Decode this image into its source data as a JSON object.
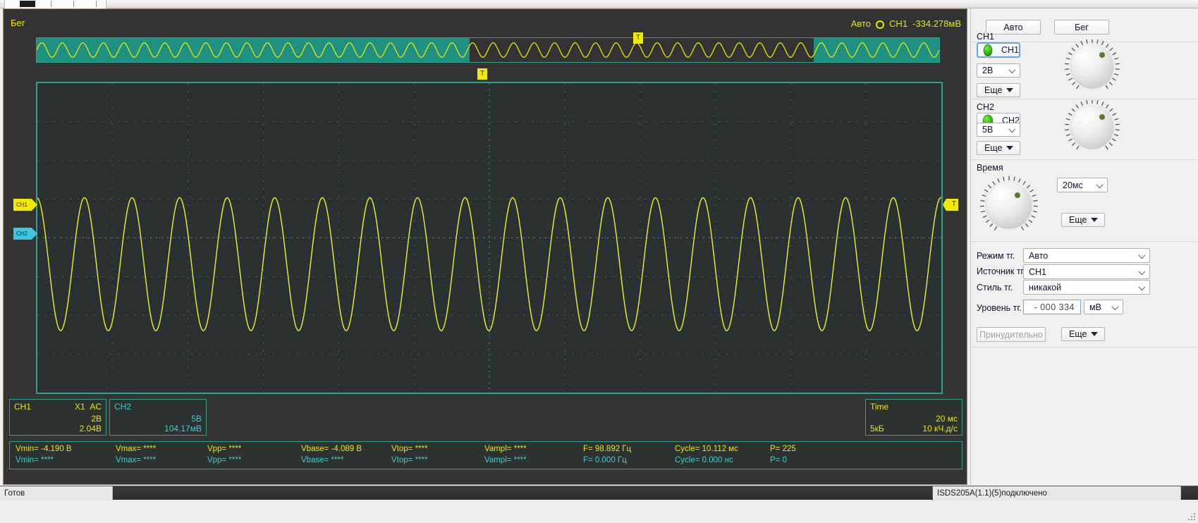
{
  "window": {
    "tab_title": ""
  },
  "scope": {
    "run_label": "Бег",
    "top_status": {
      "mode": "Авто",
      "trigger_icon": "trigger-circle-icon",
      "channel": "CH1",
      "level": "-334.278мВ"
    },
    "overview": {
      "t_marker_label": "T"
    },
    "grid": {
      "t_marker_label": "T",
      "ch1_marker": "CH1",
      "ch2_marker": "CH2",
      "right_marker": "T"
    },
    "ch1_box": {
      "title": "CH1",
      "probe": "X1",
      "coupling": "AC",
      "scale": "2В",
      "offset": "2.04В"
    },
    "ch2_box": {
      "title": "CH2",
      "scale": "5В",
      "offset": "104.17мВ"
    },
    "time_box": {
      "title": "Time",
      "timebase": "20 мс",
      "depth": "5кБ",
      "samplerate": "10 кЧ.д/с"
    },
    "measurements": {
      "ch1": [
        {
          "label": "Vmin=",
          "value": "-4.190 В"
        },
        {
          "label": "Vmax=",
          "value": "****"
        },
        {
          "label": "Vpp=",
          "value": "****"
        },
        {
          "label": "Vbase=",
          "value": "-4.089 В"
        },
        {
          "label": "Vtop=",
          "value": "****"
        },
        {
          "label": "Vampl=",
          "value": "****"
        },
        {
          "label": "F=",
          "value": "98.892 Гц"
        },
        {
          "label": "Cycle=",
          "value": "10.112 мс"
        },
        {
          "label": "P=",
          "value": "225"
        }
      ],
      "ch2": [
        {
          "label": "Vmin=",
          "value": "****"
        },
        {
          "label": "Vmax=",
          "value": "****"
        },
        {
          "label": "Vpp=",
          "value": "****"
        },
        {
          "label": "Vbase=",
          "value": "****"
        },
        {
          "label": "Vtop=",
          "value": "****"
        },
        {
          "label": "Vampl=",
          "value": "****"
        },
        {
          "label": "F=",
          "value": "0.000 Гц"
        },
        {
          "label": "Cycle=",
          "value": "0.000 нс"
        },
        {
          "label": "P=",
          "value": "0"
        }
      ]
    }
  },
  "panel": {
    "auto_button": "Авто",
    "run_button": "Бег",
    "ch1": {
      "group_label": "CH1",
      "toggle_label": "CH1",
      "scale_value": "2В",
      "more_label": "Еще"
    },
    "ch2": {
      "group_label": "CH2",
      "toggle_label": "CH2",
      "scale_value": "5В",
      "more_label": "Еще"
    },
    "time": {
      "group_label": "Время",
      "value": "20мс",
      "more_label": "Еще"
    },
    "trigger": {
      "mode_label": "Режим тг.",
      "mode_value": "Авто",
      "source_label": "Источник тг.",
      "source_value": "CH1",
      "style_label": "Стиль тг.",
      "style_value": "никакой",
      "level_label": "Уровень тг.",
      "level_value": "- 000 334",
      "level_unit": "мВ",
      "force_label": "Принудительно",
      "more_label": "Еще"
    }
  },
  "statusbar": {
    "ready": "Готов",
    "device": "ISDS205A(1.1)(5)подключено"
  },
  "colors": {
    "ch1": "#e8e800",
    "ch2": "#35d2d2",
    "grid_border": "#2ea08c",
    "scope_bg": "#333333",
    "grid_bg": "#2a3130",
    "overview_sel": "#1f9180"
  },
  "waveform": {
    "type": "sine",
    "cycles_main": 19,
    "cycles_overview": 44,
    "amplitude_div": 2.0,
    "vmin": -4.19,
    "frequency_hz": 98.892
  }
}
